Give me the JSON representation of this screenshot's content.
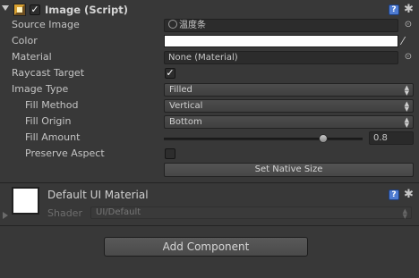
{
  "component": {
    "title": "Image (Script)",
    "enabled": true,
    "icon": "image-component-icon",
    "help_icon": "?",
    "gear_icon": "gear-icon"
  },
  "properties": {
    "source_image": {
      "label": "Source Image",
      "value": "温度条"
    },
    "color": {
      "label": "Color",
      "value": "#ffffff"
    },
    "material": {
      "label": "Material",
      "value": "None (Material)"
    },
    "raycast_target": {
      "label": "Raycast Target",
      "checked": true
    },
    "image_type": {
      "label": "Image Type",
      "value": "Filled"
    },
    "fill_method": {
      "label": "Fill Method",
      "value": "Vertical"
    },
    "fill_origin": {
      "label": "Fill Origin",
      "value": "Bottom"
    },
    "fill_amount": {
      "label": "Fill Amount",
      "value": "0.8",
      "fraction": 0.8
    },
    "preserve_aspect": {
      "label": "Preserve Aspect",
      "checked": false
    },
    "set_native_size": "Set Native Size"
  },
  "material_section": {
    "title": "Default UI Material",
    "shader_label": "Shader",
    "shader_value": "UI/Default"
  },
  "add_component": "Add Component",
  "colors": {
    "background": "#383838",
    "field": "#2c2c2c",
    "help_blue": "#4e7bd1"
  }
}
